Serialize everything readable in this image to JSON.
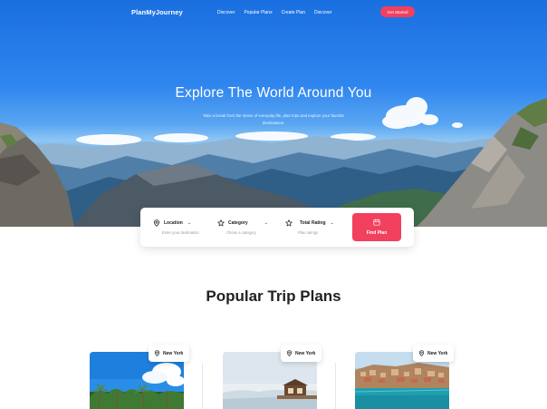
{
  "nav": {
    "brand": "PlanMyJourney",
    "links": [
      "Discover",
      "Popular Plans",
      "Create Plan",
      "Discover"
    ],
    "cta": "Get Started"
  },
  "hero": {
    "title": "Explore The World Around You",
    "subtitle": "Take a break from the stress of everyday life, plan trips and explore your favorite destinations."
  },
  "search": {
    "fields": [
      {
        "label": "Location",
        "hint": "Enter your destination",
        "icon": "map-pin-icon"
      },
      {
        "label": "Category",
        "hint": "Chose a category",
        "icon": "star-icon"
      },
      {
        "label": "Total Rating",
        "hint": "Plan ratings",
        "icon": "star-icon"
      }
    ],
    "button": {
      "label": "Find Plan",
      "icon": "calendar-icon"
    }
  },
  "popular": {
    "title": "Popular Trip Plans",
    "cards": [
      {
        "location": "New York",
        "image": "tropical-beach-palms"
      },
      {
        "location": "New York",
        "image": "coastal-villa-sea"
      },
      {
        "location": "New York",
        "image": "harbor-town-turquoise-water"
      }
    ]
  },
  "colors": {
    "accent": "#f2405f",
    "sky": "#2f86ee",
    "text": "#222222"
  }
}
